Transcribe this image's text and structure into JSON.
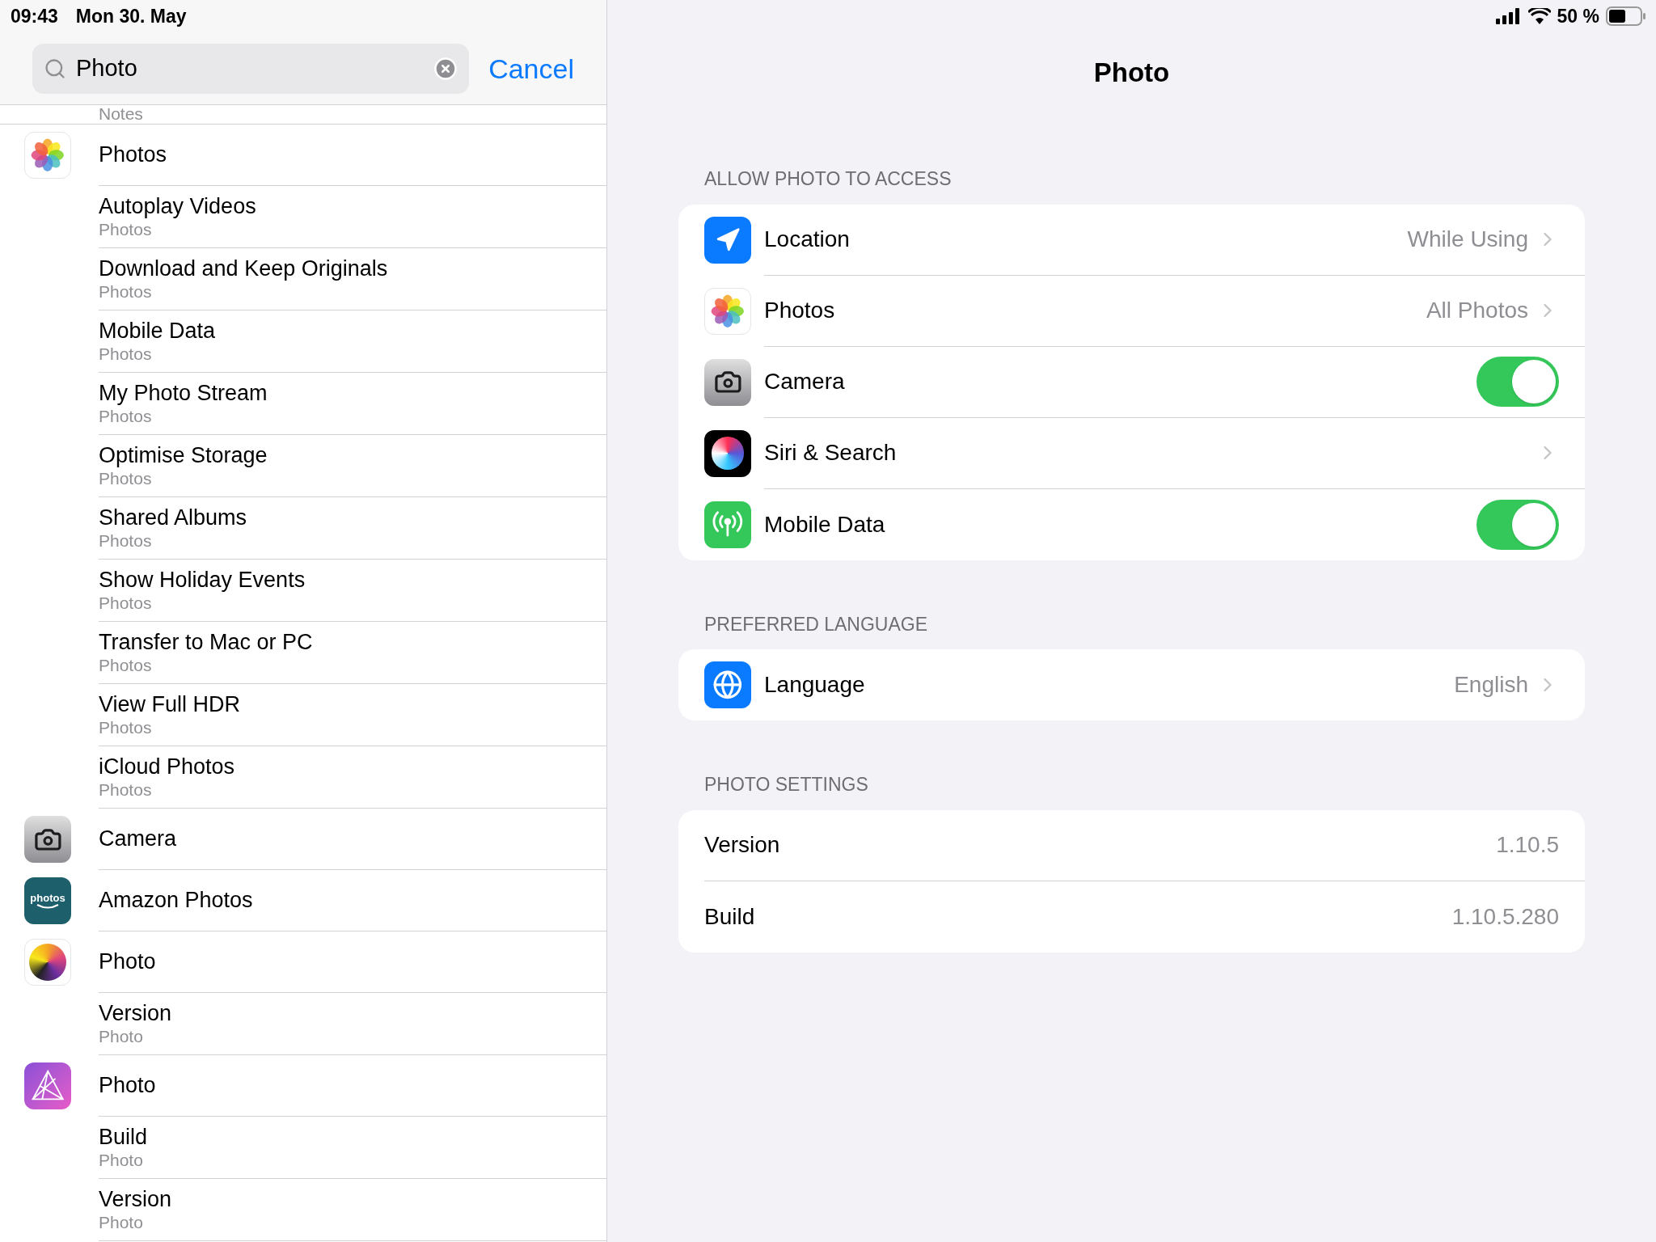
{
  "status_bar": {
    "time": "09:43",
    "date": "Mon 30. May",
    "battery": "50 %"
  },
  "search": {
    "value": "Photo",
    "cancel": "Cancel"
  },
  "results": [
    {
      "kind": "partial",
      "subtitle": "Notes"
    },
    {
      "kind": "photos",
      "title": "Photos"
    },
    {
      "kind": "setting",
      "title": "Autoplay Videos",
      "subtitle": "Photos"
    },
    {
      "kind": "setting",
      "title": "Download and Keep Originals",
      "subtitle": "Photos"
    },
    {
      "kind": "setting",
      "title": "Mobile Data",
      "subtitle": "Photos"
    },
    {
      "kind": "setting",
      "title": "My Photo Stream",
      "subtitle": "Photos"
    },
    {
      "kind": "setting",
      "title": "Optimise Storage",
      "subtitle": "Photos"
    },
    {
      "kind": "setting",
      "title": "Shared Albums",
      "subtitle": "Photos"
    },
    {
      "kind": "setting",
      "title": "Show Holiday Events",
      "subtitle": "Photos"
    },
    {
      "kind": "setting",
      "title": "Transfer to Mac or PC",
      "subtitle": "Photos"
    },
    {
      "kind": "setting",
      "title": "View Full HDR",
      "subtitle": "Photos"
    },
    {
      "kind": "setting",
      "title": "iCloud Photos",
      "subtitle": "Photos"
    },
    {
      "kind": "camera",
      "title": "Camera"
    },
    {
      "kind": "amazon",
      "icon_text": "photos",
      "title": "Amazon Photos"
    },
    {
      "kind": "sphere",
      "title": "Photo"
    },
    {
      "kind": "setting",
      "title": "Version",
      "subtitle": "Photo"
    },
    {
      "kind": "affinity",
      "title": "Photo"
    },
    {
      "kind": "setting",
      "title": "Build",
      "subtitle": "Photo"
    },
    {
      "kind": "setting",
      "title": "Version",
      "subtitle": "Photo"
    }
  ],
  "detail": {
    "title": "Photo",
    "sections": [
      {
        "header": "ALLOW PHOTO TO ACCESS",
        "rows": [
          {
            "kind": "link",
            "label": "Location",
            "value": "While Using"
          },
          {
            "kind": "link",
            "label": "Photos",
            "value": "All Photos"
          },
          {
            "kind": "toggle",
            "label": "Camera",
            "on": true
          },
          {
            "kind": "link",
            "label": "Siri & Search"
          },
          {
            "kind": "toggle",
            "label": "Mobile Data",
            "on": true
          }
        ]
      },
      {
        "header": "PREFERRED LANGUAGE",
        "rows": [
          {
            "kind": "link",
            "label": "Language",
            "value": "English"
          }
        ]
      },
      {
        "header": "PHOTO SETTINGS",
        "rows": [
          {
            "kind": "info",
            "label": "Version",
            "value": "1.10.5"
          },
          {
            "kind": "info",
            "label": "Build",
            "value": "1.10.5.280"
          }
        ]
      }
    ]
  }
}
